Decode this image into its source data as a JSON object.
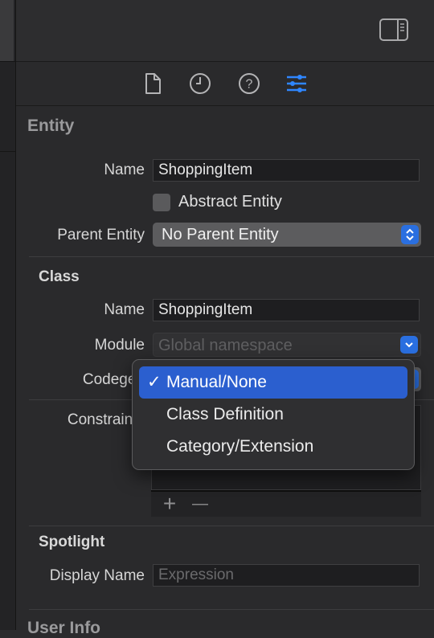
{
  "tabs": [
    {
      "icon": "file-inspector-icon"
    },
    {
      "icon": "history-inspector-icon"
    },
    {
      "icon": "help-inspector-icon"
    },
    {
      "icon": "attributes-inspector-icon",
      "active": true
    }
  ],
  "entity": {
    "section_title": "Entity",
    "name_label": "Name",
    "name_value": "ShoppingItem",
    "abstract_label": "Abstract Entity",
    "parent_label": "Parent Entity",
    "parent_value": "No Parent Entity"
  },
  "class": {
    "section_title": "Class",
    "name_label": "Name",
    "name_value": "ShoppingItem",
    "module_label": "Module",
    "module_placeholder": "Global namespace",
    "codegen_label": "Codegen"
  },
  "constraints": {
    "label": "Constraints",
    "add_label": "+",
    "remove_label": "—"
  },
  "codegen_menu": {
    "items": [
      {
        "label": "Manual/None",
        "selected": true,
        "check": "✓"
      },
      {
        "label": "Class Definition",
        "selected": false,
        "check": ""
      },
      {
        "label": "Category/Extension",
        "selected": false,
        "check": ""
      }
    ]
  },
  "spotlight": {
    "section_title": "Spotlight",
    "display_name_label": "Display Name",
    "display_name_placeholder": "Expression"
  },
  "user_info": {
    "section_title": "User Info"
  },
  "colors": {
    "accent": "#2a6fe0",
    "menu_selection": "#2b5fcf",
    "background": "#2a2a2c"
  }
}
